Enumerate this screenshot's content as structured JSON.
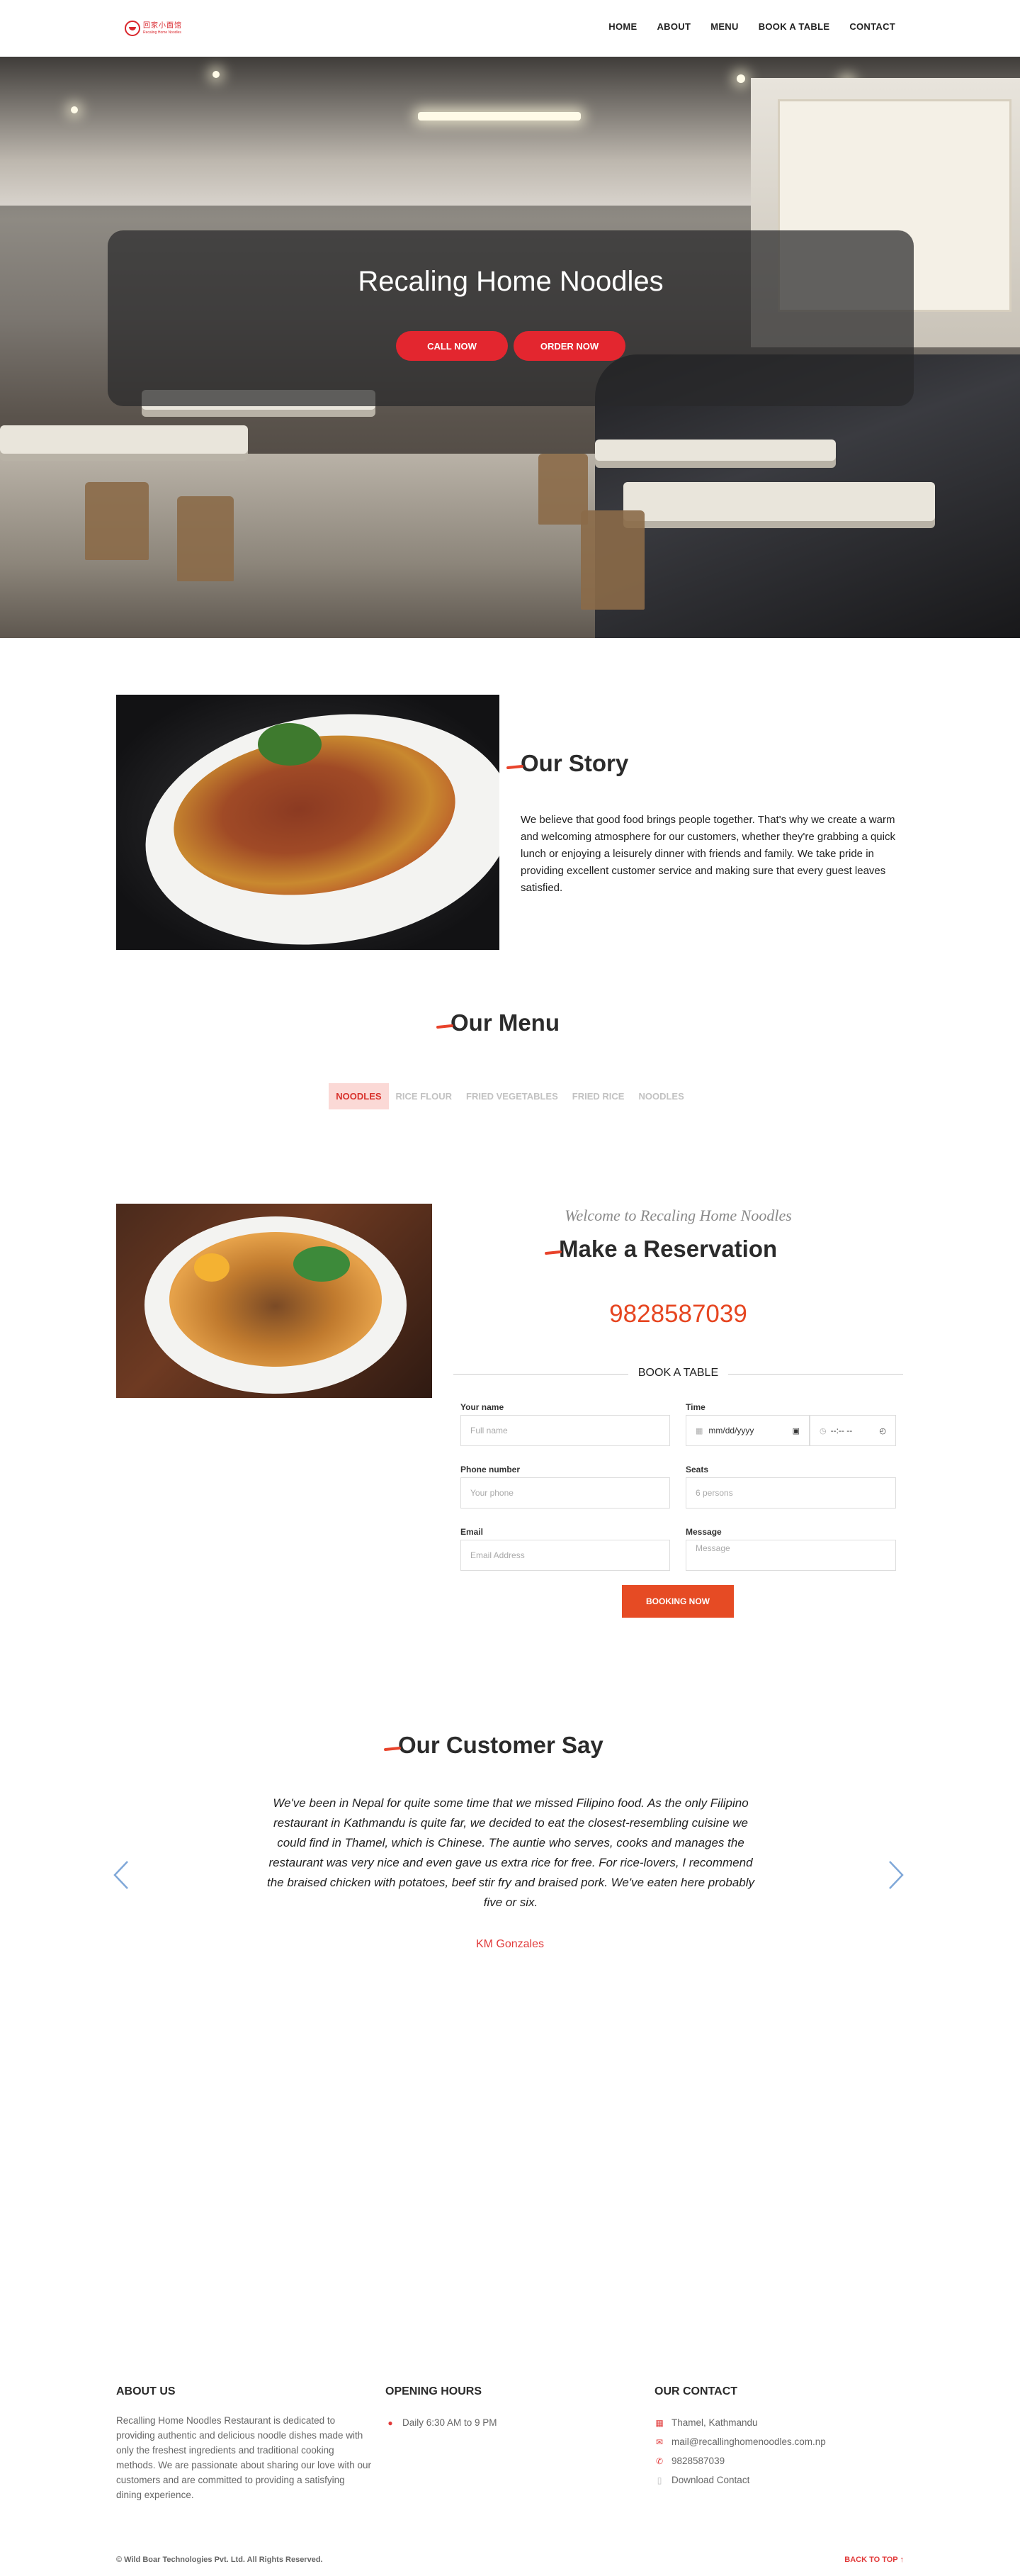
{
  "nav": {
    "logo_cn": "回家小面馆",
    "logo_en": "Recaling Home Noodles",
    "items": [
      "HOME",
      "ABOUT",
      "MENU",
      "BOOK A TABLE",
      "CONTACT"
    ]
  },
  "hero": {
    "title": "Recaling Home Noodles",
    "call_label": "CALL NOW",
    "order_label": "ORDER NOW"
  },
  "story": {
    "title": "Our Story",
    "text": "We believe that good food brings people together. That's why we create a warm and welcoming atmosphere for our customers, whether they're grabbing a quick lunch or enjoying a leisurely dinner with friends and family. We take pride in providing excellent customer service and making sure that every guest leaves satisfied."
  },
  "menu": {
    "title": "Our Menu",
    "tabs": [
      "NOODLES",
      "RICE FLOUR",
      "FRIED VEGETABLES",
      "FRIED RICE",
      "NOODLES"
    ],
    "active_index": 0
  },
  "reservation": {
    "welcome": "Welcome to Recaling Home Noodles",
    "title": "Make a Reservation",
    "phone": "9828587039",
    "book_label": "BOOK A TABLE",
    "fields": {
      "name_label": "Your name",
      "name_placeholder": "Full name",
      "time_label": "Time",
      "date_value": "mm/dd/yyyy",
      "time_value": "--:-- --",
      "phone_label": "Phone number",
      "phone_placeholder": "Your phone",
      "seats_label": "Seats",
      "seats_placeholder": "6 persons",
      "email_label": "Email",
      "email_placeholder": "Email Address",
      "message_label": "Message",
      "message_placeholder": "Message"
    },
    "submit_label": "BOOKING NOW"
  },
  "testimonial": {
    "title": "Our Customer Say",
    "quote": "We've been in Nepal for quite some time that we missed Filipino food. As the only Filipino restaurant in Kathmandu is quite far, we decided to eat the closest-resembling cuisine we could find in Thamel, which is Chinese. The auntie who serves, cooks and manages the restaurant was very nice and even gave us extra rice for free. For rice-lovers, I recommend the braised chicken with potatoes, beef stir fry and braised pork. We've eaten here probably five or six.",
    "author": "KM Gonzales"
  },
  "footer": {
    "about_title": "ABOUT US",
    "about_text": "Recalling Home Noodles Restaurant is dedicated to providing authentic and delicious noodle dishes made with only the freshest ingredients and traditional cooking methods. We are passionate about sharing our love with our customers and are committed to providing a satisfying dining experience.",
    "hours_title": "OPENING HOURS",
    "hours": "Daily 6:30 AM to 9 PM",
    "contact_title": "OUR CONTACT",
    "address": "Thamel, Kathmandu",
    "email": "mail@recallinghomenoodles.com.np",
    "phone": "9828587039",
    "download": "Download Contact",
    "copyright": "© Wild Boar Technologies Pvt. Ltd. All Rights Reserved.",
    "back_to_top": "BACK TO TOP ↑"
  },
  "colors": {
    "accent": "#e3262f",
    "orange": "#e64b24",
    "tab_active_bg": "#fbd9d6"
  }
}
